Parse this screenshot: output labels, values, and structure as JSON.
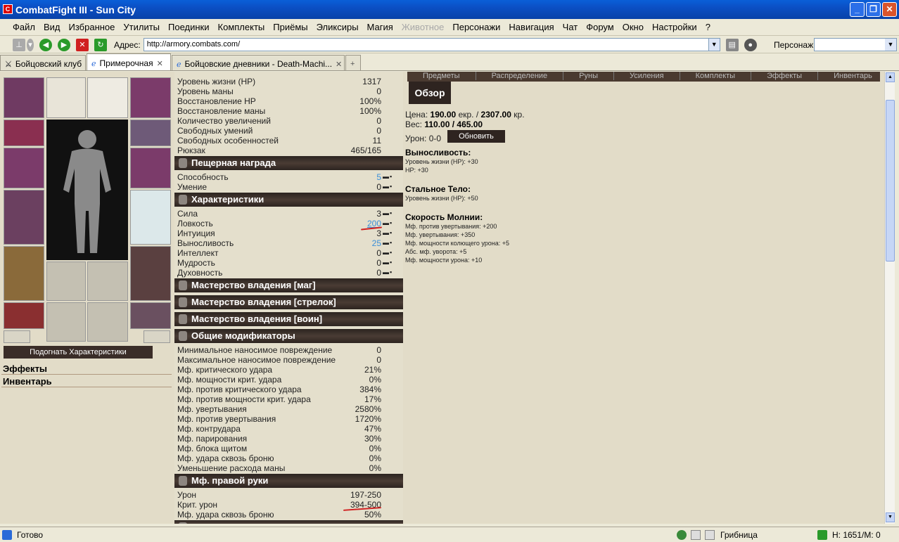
{
  "window": {
    "title": "CombatFight III - Sun City",
    "minimize": "_",
    "restore": "❐",
    "close": "✕"
  },
  "menu": [
    "Файл",
    "Вид",
    "Избранное",
    "Утилиты",
    "Поединки",
    "Комплекты",
    "Приёмы",
    "Эликсиры",
    "Магия",
    "Животное",
    "Персонажи",
    "Навигация",
    "Чат",
    "Форум",
    "Окно",
    "Настройки",
    "?"
  ],
  "toolbar": {
    "address_label": "Адрес:",
    "address_value": "http://armory.combats.com/",
    "persona_label": "Персонаж:",
    "persona_value": ""
  },
  "tabs": [
    {
      "label": "Бойцовский клуб"
    },
    {
      "label": "Примерочная"
    },
    {
      "label": "Бойцовские дневники - Death-Machi..."
    }
  ],
  "left": {
    "fit_button": "Подогнать Характеристики",
    "sections": [
      "Эффекты",
      "Инвентарь"
    ]
  },
  "stats_top": [
    {
      "label": "Уровень жизни (HP)",
      "value": "1317"
    },
    {
      "label": "Уровень маны",
      "value": "0"
    },
    {
      "label": "Восстановление HP",
      "value": "100%"
    },
    {
      "label": "Восстановление маны",
      "value": "100%"
    },
    {
      "label": "Количество увеличений",
      "value": "0"
    },
    {
      "label": "Свободных умений",
      "value": "0"
    },
    {
      "label": "Свободных особенностей",
      "value": "11"
    },
    {
      "label": "Рюкзак",
      "value": "465/165"
    }
  ],
  "cave": {
    "title": "Пещерная награда",
    "rows": [
      {
        "label": "Способность",
        "value": "5"
      },
      {
        "label": "Умение",
        "value": "0"
      }
    ]
  },
  "chars": {
    "title": "Характеристики",
    "rows": [
      {
        "label": "Сила",
        "value": "3"
      },
      {
        "label": "Ловкость",
        "value": "200"
      },
      {
        "label": "Интуиция",
        "value": "3"
      },
      {
        "label": "Выносливость",
        "value": "25"
      },
      {
        "label": "Интеллект",
        "value": "0"
      },
      {
        "label": "Мудрость",
        "value": "0"
      },
      {
        "label": "Духовность",
        "value": "0"
      }
    ]
  },
  "mastery": [
    "Мастерство владения [маг]",
    "Мастерство владения [стрелок]",
    "Мастерство владения [воин]"
  ],
  "mods": {
    "title": "Общие модификаторы",
    "rows": [
      {
        "label": "Минимальное наносимое повреждение",
        "value": "0"
      },
      {
        "label": "Максимальное наносимое повреждение",
        "value": "0"
      },
      {
        "label": "Мф. критического удара",
        "value": "21%"
      },
      {
        "label": "Мф. мощности крит. удара",
        "value": "0%"
      },
      {
        "label": "Мф. против критического удара",
        "value": "384%"
      },
      {
        "label": "Мф. против мощности крит. удара",
        "value": "17%"
      },
      {
        "label": "Мф. увертывания",
        "value": "2580%"
      },
      {
        "label": "Мф. против увертывания",
        "value": "1720%"
      },
      {
        "label": "Мф. контрудара",
        "value": "47%"
      },
      {
        "label": "Мф. парирования",
        "value": "30%"
      },
      {
        "label": "Мф. блока щитом",
        "value": "0%"
      },
      {
        "label": "Мф. удара сквозь броню",
        "value": "0%"
      },
      {
        "label": "Уменьшение расхода маны",
        "value": "0%"
      }
    ]
  },
  "right_hand": {
    "title": "Мф. правой руки",
    "rows": [
      {
        "label": "Урон",
        "value": "197-250"
      },
      {
        "label": "Крит. урон",
        "value": "394-500"
      },
      {
        "label": "Мф. удара сквозь броню",
        "value": "50%"
      }
    ]
  },
  "right": {
    "tabs": [
      "Предметы",
      "Распределение",
      "Руны",
      "Усиления",
      "Комплекты",
      "Эффекты",
      "Инвентарь"
    ],
    "active_tab": "Обзор",
    "price_label": "Цена:",
    "price_ekr": "190.00",
    "price_ekr_unit": "екр. /",
    "price_kr": "2307.00",
    "price_kr_unit": "кр.",
    "weight_label": "Вес:",
    "weight_value": "110.00 / 465.00",
    "damage_label": "Урон: 0-0",
    "update_button": "Обновить",
    "sections": [
      {
        "title": "Выносливость:",
        "lines": [
          "Уровень жизни (HP): +30",
          "HP: +30"
        ]
      },
      {
        "title": "Стальное Тело:",
        "lines": [
          "Уровень жизни (HP): +50"
        ]
      },
      {
        "title": "Скорость Молнии:",
        "lines": [
          "Мф. против увертывания: +200",
          "Мф. увертывания: +350",
          "Мф. мощности колющего урона: +5",
          "Абс. мф. уворота: +5",
          "Мф. мощности урона: +10"
        ]
      }
    ]
  },
  "status": {
    "ready": "Готово",
    "user": "Грибница",
    "counter": "Н: 1651/М: 0"
  },
  "colors": {
    "header_bg": "#2c2420",
    "panel_bg": "#e2dcc8",
    "accent_blue": "#3a8fd9",
    "titlebar": "#0b4fc4"
  }
}
